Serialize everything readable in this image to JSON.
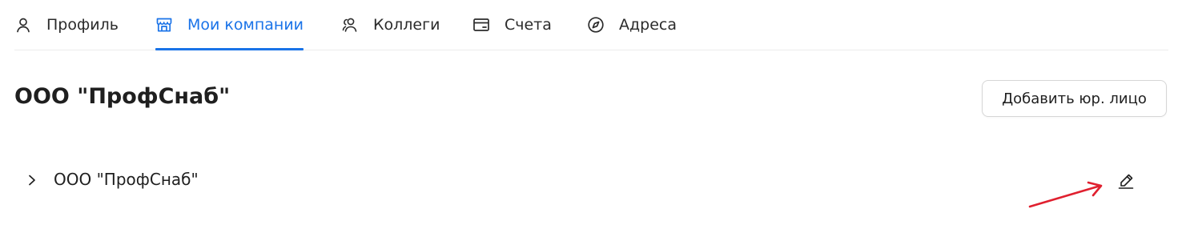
{
  "tabs": [
    {
      "label": "Профиль",
      "icon": "person-icon",
      "active": false
    },
    {
      "label": "Мои компании",
      "icon": "storefront-icon",
      "active": true
    },
    {
      "label": "Коллеги",
      "icon": "people-icon",
      "active": false
    },
    {
      "label": "Счета",
      "icon": "card-icon",
      "active": false
    },
    {
      "label": "Адреса",
      "icon": "compass-icon",
      "active": false
    }
  ],
  "header": {
    "title": "ООО \"ПрофСнаб\"",
    "add_button_label": "Добавить юр. лицо"
  },
  "companies": [
    {
      "name": "ООО \"ПрофСнаб\"",
      "expanded": false
    }
  ],
  "colors": {
    "accent": "#1a73e8",
    "text": "#1f1f1f",
    "divider": "#ececec",
    "annotation": "#e0202f"
  }
}
